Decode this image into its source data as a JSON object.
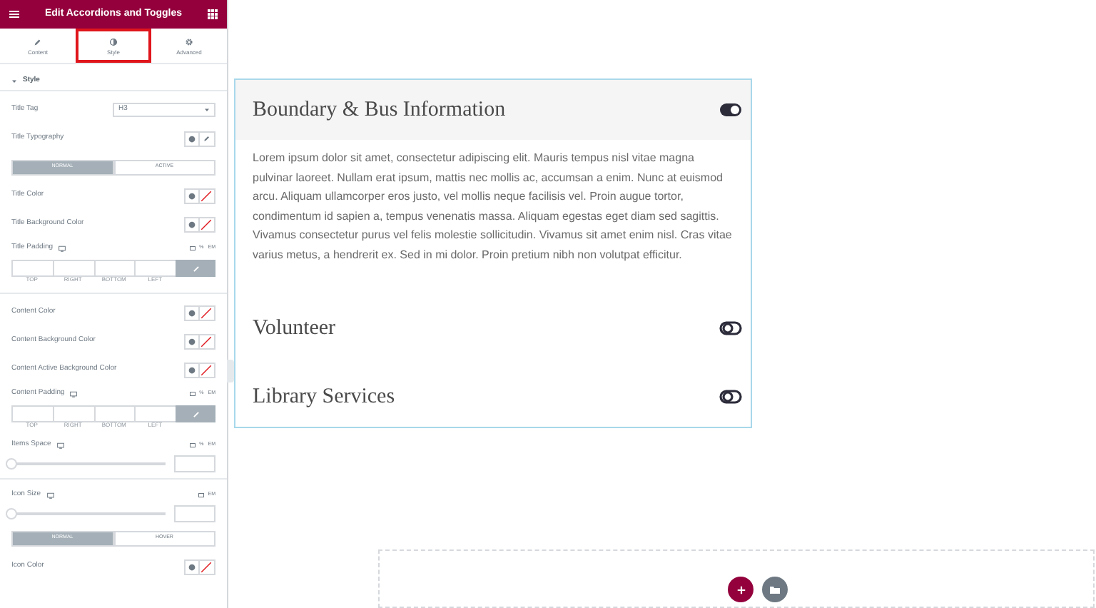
{
  "panel": {
    "title": "Edit Accordions and Toggles",
    "tabs": [
      {
        "label": "Content",
        "selected": false
      },
      {
        "label": "Style",
        "selected": true
      },
      {
        "label": "Advanced",
        "selected": false
      }
    ],
    "section": {
      "label": "Style",
      "expanded": true
    },
    "groups": [
      [
        {
          "kind": "select",
          "label": "Title Tag",
          "value": "H3"
        },
        {
          "kind": "typography",
          "label": "Title Typography"
        },
        {
          "kind": "state_tabs",
          "options": [
            {
              "label": "NORMAL",
              "selected": true
            },
            {
              "label": "ACTIVE",
              "selected": false
            }
          ]
        },
        {
          "kind": "color",
          "label": "Title Color"
        },
        {
          "kind": "color",
          "label": "Title Background Color"
        },
        {
          "kind": "dimensions",
          "label": "Title Padding",
          "units": [
            "%",
            "EM"
          ],
          "sides": [
            "TOP",
            "RIGHT",
            "BOTTOM",
            "LEFT"
          ]
        }
      ],
      [
        {
          "kind": "color",
          "label": "Content Color"
        },
        {
          "kind": "color",
          "label": "Content Background Color"
        },
        {
          "kind": "color",
          "label": "Content Active Background Color"
        },
        {
          "kind": "dimensions",
          "label": "Content Padding",
          "units": [
            "%",
            "EM"
          ],
          "sides": [
            "TOP",
            "RIGHT",
            "BOTTOM",
            "LEFT"
          ]
        },
        {
          "kind": "slider",
          "label": "Items Space",
          "units": [
            "%",
            "EM"
          ],
          "level": 0
        }
      ],
      [
        {
          "kind": "slider",
          "label": "Icon Size",
          "units": [
            "EM"
          ],
          "level": 0
        },
        {
          "kind": "state_tabs",
          "options": [
            {
              "label": "NORMAL",
              "selected": true
            },
            {
              "label": "HOVER",
              "selected": false
            }
          ]
        },
        {
          "kind": "color",
          "label": "Icon Color"
        }
      ]
    ]
  },
  "accordion": [
    {
      "title": "Boundary & Bus Information",
      "expanded": true,
      "content": "Lorem ipsum dolor sit amet, consectetur adipiscing elit. Mauris tempus nisl vitae magna pulvinar laoreet. Nullam erat ipsum, mattis nec mollis ac, accumsan a enim. Nunc at euismod arcu. Aliquam ullamcorper eros justo, vel mollis neque facilisis vel. Proin augue tortor, condimentum id sapien a, tempus venenatis massa. Aliquam egestas eget diam sed sagittis. Vivamus consectetur purus vel felis molestie sollicitudin. Vivamus sit amet enim nisl. Cras vitae varius metus, a hendrerit ex. Sed in mi dolor. Proin pretium nibh non volutpat efficitur."
    },
    {
      "title": "Volunteer",
      "expanded": false
    },
    {
      "title": "Library Services",
      "expanded": false
    }
  ]
}
